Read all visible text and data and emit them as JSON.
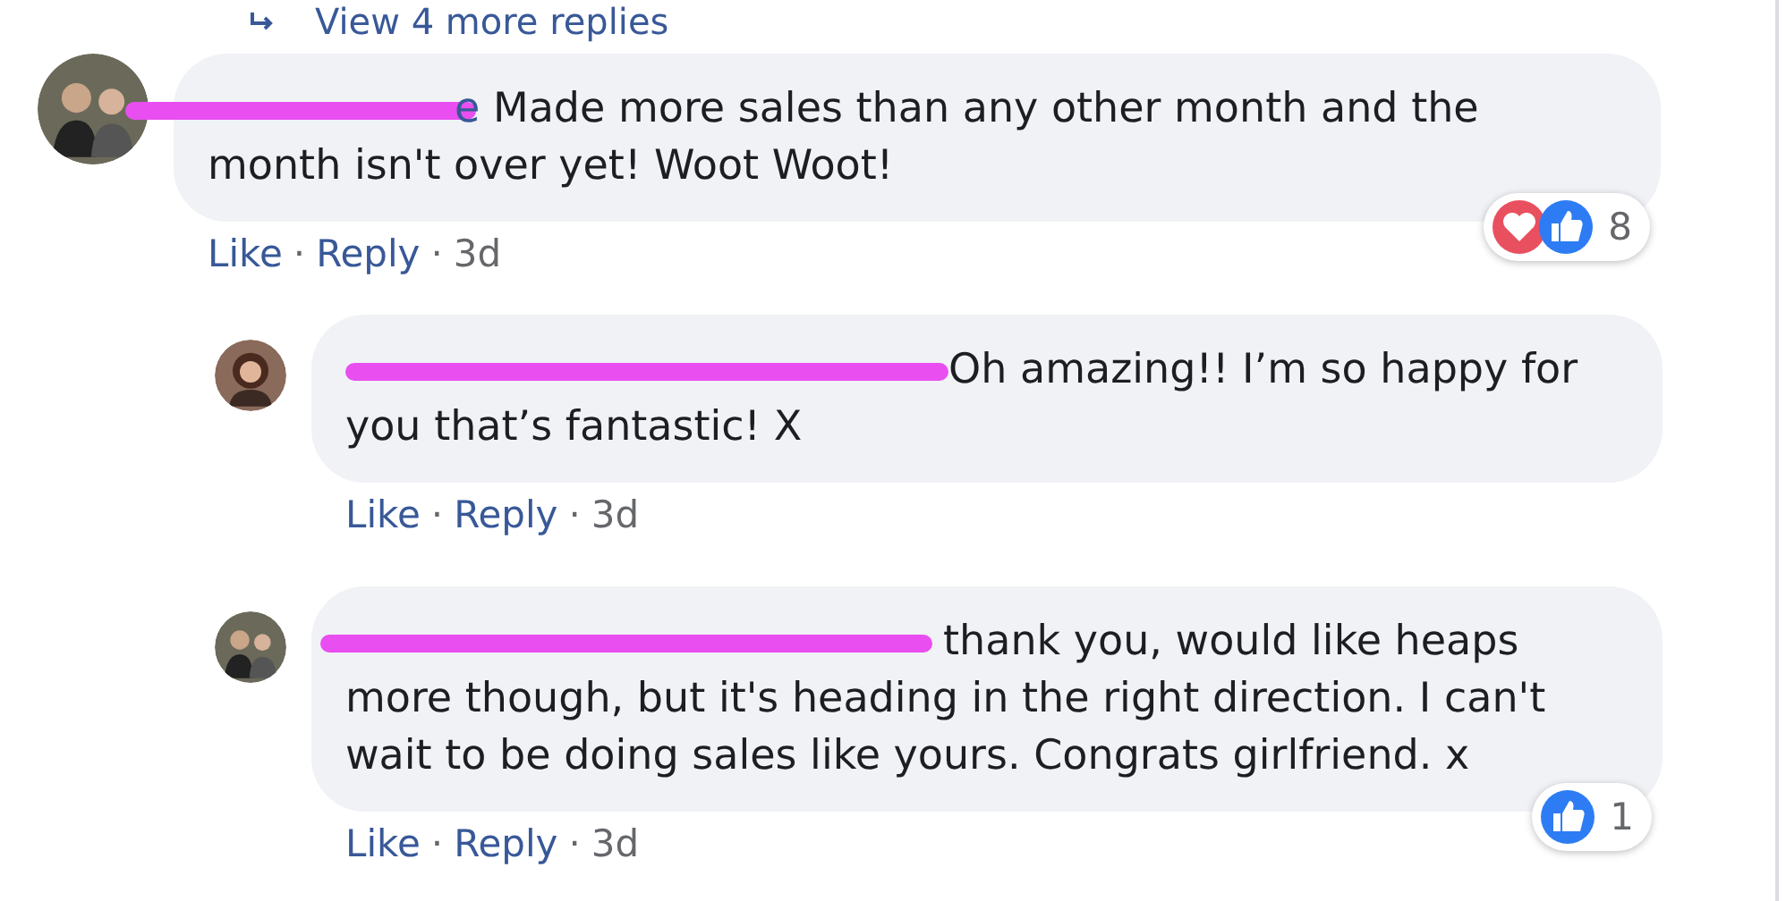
{
  "more_replies": {
    "label": "View 4 more replies"
  },
  "comments": [
    {
      "kind": "comment",
      "avatar": {
        "kind": "couple"
      },
      "name_fragment": "e",
      "text": "Made more sales than any other month and the month isn't over yet! Woot Woot!",
      "actions": [
        {
          "kind": "link",
          "label": "Like"
        },
        {
          "kind": "dot",
          "label": "·"
        },
        {
          "kind": "link",
          "label": "Reply"
        },
        {
          "kind": "dot",
          "label": "·"
        }
      ],
      "time": "3d",
      "reactions": {
        "icons": [
          {
            "kind": "love"
          },
          {
            "kind": "like"
          }
        ],
        "count": "8"
      }
    },
    {
      "kind": "reply",
      "avatar": {
        "kind": "woman"
      },
      "text": "Oh amazing!! I’m so happy for you that’s fantastic! X",
      "actions": [
        {
          "kind": "link",
          "label": "Like"
        },
        {
          "kind": "dot",
          "label": "·"
        },
        {
          "kind": "link",
          "label": "Reply"
        },
        {
          "kind": "dot",
          "label": "·"
        }
      ],
      "time": "3d"
    },
    {
      "kind": "reply",
      "avatar": {
        "kind": "couple"
      },
      "text": "thank you, would like heaps more though, but it's heading in the right direction. I can't wait to be doing sales like yours. Congrats girlfriend. x",
      "actions": [
        {
          "kind": "link",
          "label": "Like"
        },
        {
          "kind": "dot",
          "label": "·"
        },
        {
          "kind": "link",
          "label": "Reply"
        },
        {
          "kind": "dot",
          "label": "·"
        }
      ],
      "time": "3d",
      "reactions": {
        "icons": [
          {
            "kind": "like"
          }
        ],
        "count": "1"
      }
    }
  ]
}
